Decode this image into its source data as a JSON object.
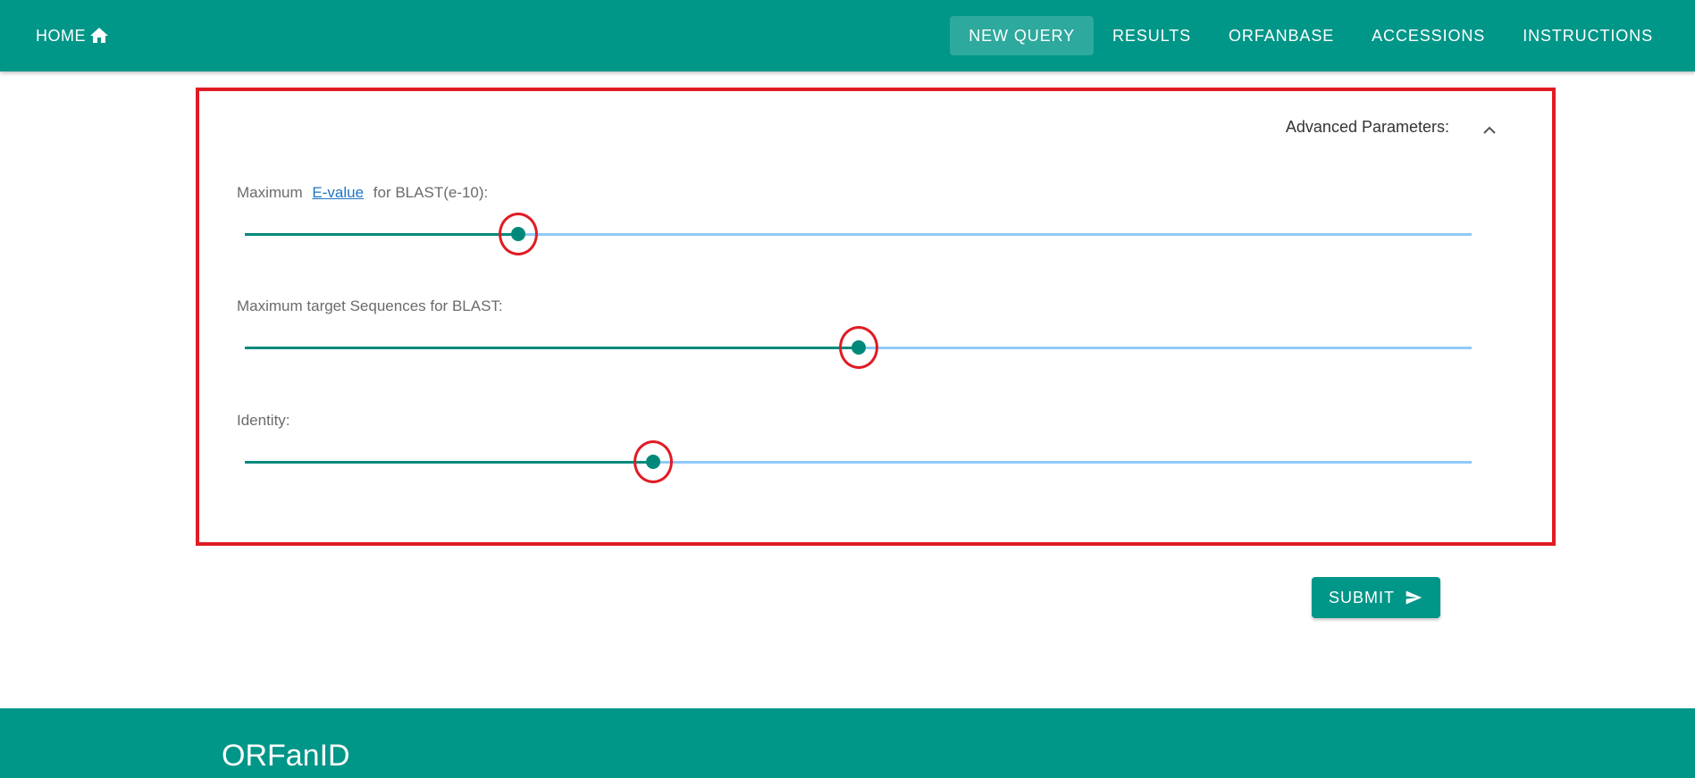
{
  "header": {
    "home_label": "HOME",
    "home_icon": "home-icon",
    "nav": [
      {
        "label": "NEW QUERY",
        "active": true
      },
      {
        "label": "RESULTS",
        "active": false
      },
      {
        "label": "ORFANBASE",
        "active": false
      },
      {
        "label": "ACCESSIONS",
        "active": false
      },
      {
        "label": "INSTRUCTIONS",
        "active": false
      }
    ]
  },
  "advanced": {
    "title": "Advanced Parameters:",
    "toggle_icon": "chevron-up-icon",
    "params": [
      {
        "label_prefix": "Maximum",
        "link": "E-value",
        "label_suffix": "for BLAST(e-10):",
        "fraction": 0.223
      },
      {
        "label": "Maximum target Sequences for BLAST:",
        "fraction": 0.5
      },
      {
        "label": "Identity:",
        "fraction": 0.333
      }
    ]
  },
  "submit": {
    "label": "SUBMIT",
    "icon": "send-icon"
  },
  "footer": {
    "brand": "ORFanID"
  },
  "colors": {
    "primary": "#009688",
    "slider_active": "#00897b",
    "slider_rail": "#90caf9",
    "highlight": "#e01b24",
    "link": "#1e74c6"
  }
}
